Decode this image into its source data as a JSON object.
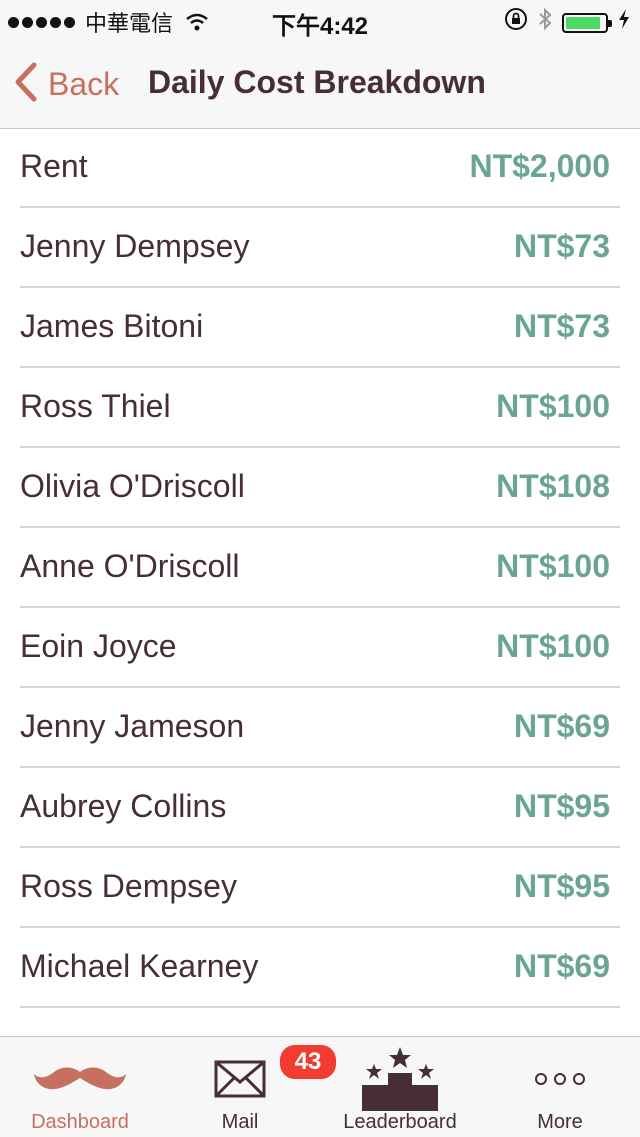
{
  "status_bar": {
    "carrier": "中華電信",
    "time": "下午4:42",
    "battery_level": 0.9
  },
  "nav": {
    "back_label": "Back",
    "title": "Daily Cost Breakdown"
  },
  "rows": [
    {
      "name": "Rent",
      "amount": "NT$2,000"
    },
    {
      "name": "Jenny Dempsey",
      "amount": "NT$73"
    },
    {
      "name": "James Bitoni",
      "amount": "NT$73"
    },
    {
      "name": "Ross Thiel",
      "amount": "NT$100"
    },
    {
      "name": "Olivia O'Driscoll",
      "amount": "NT$108"
    },
    {
      "name": "Anne O'Driscoll",
      "amount": "NT$100"
    },
    {
      "name": "Eoin Joyce",
      "amount": "NT$100"
    },
    {
      "name": "Jenny Jameson",
      "amount": "NT$69"
    },
    {
      "name": "Aubrey Collins",
      "amount": "NT$95"
    },
    {
      "name": "Ross Dempsey",
      "amount": "NT$95"
    },
    {
      "name": "Michael Kearney",
      "amount": "NT$69"
    }
  ],
  "tabs": [
    {
      "label": "Dashboard",
      "icon": "mustache-icon",
      "active": true
    },
    {
      "label": "Mail",
      "icon": "mail-icon",
      "badge": "43"
    },
    {
      "label": "Leaderboard",
      "icon": "podium-stars-icon"
    },
    {
      "label": "More",
      "icon": "more-dots-icon"
    }
  ],
  "colors": {
    "accent": "#c8705f",
    "text": "#472d37",
    "amount": "#6aa58d",
    "badge": "#f23b31"
  }
}
